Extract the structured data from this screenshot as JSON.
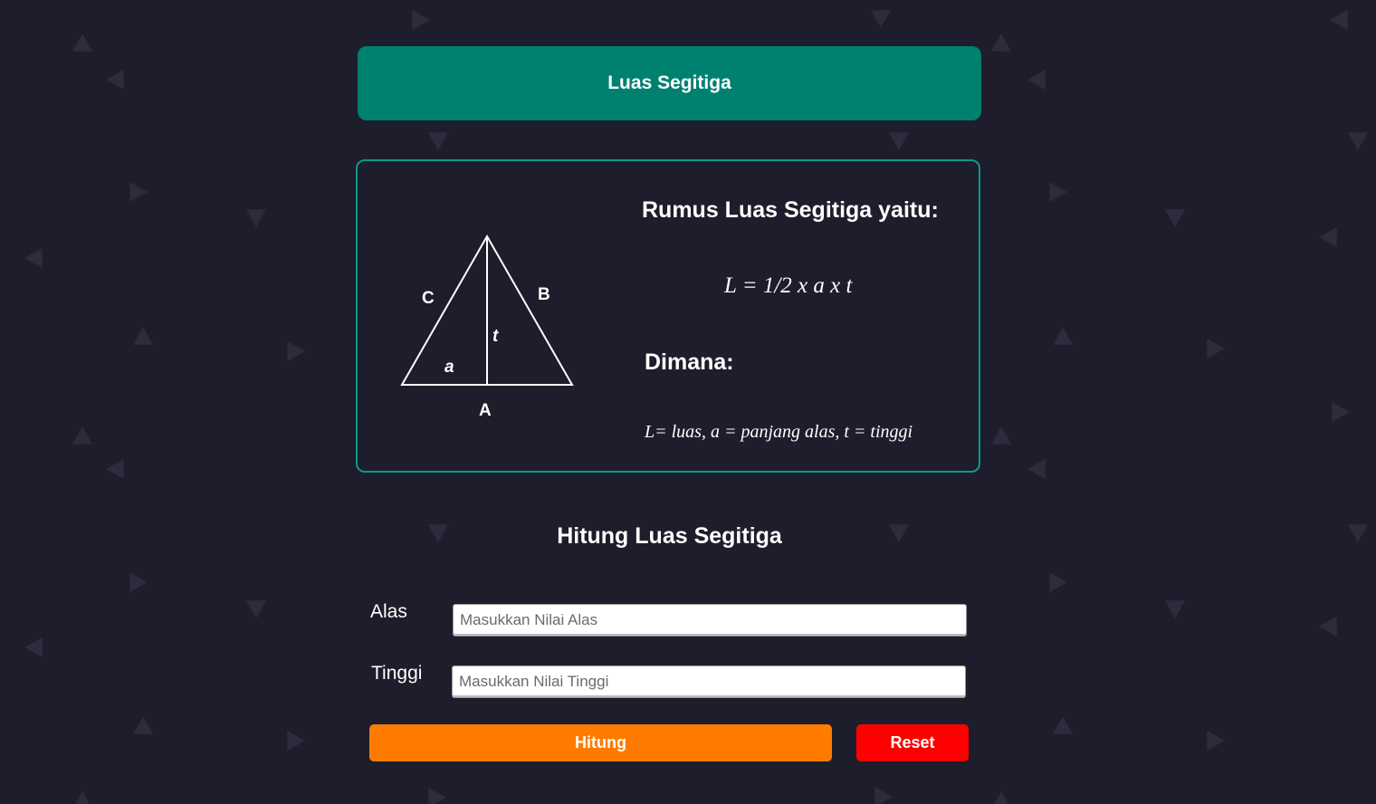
{
  "colors": {
    "background": "#1d1d2b",
    "header": "#008170",
    "card_border": "#0e9a88",
    "hitung_button": "#ff7b00",
    "reset_button": "#ff0000",
    "pattern": "#2c2c3c"
  },
  "header": {
    "title": "Luas Segitiga"
  },
  "formula_card": {
    "heading": "Rumus Luas Segitiga yaitu:",
    "equation": "L = 1/2 x a x t",
    "where_heading": "Dimana:",
    "where_description": "L= luas, a = panjang alas, t = tinggi",
    "diagram_labels": {
      "vertex_c": "C",
      "vertex_b": "B",
      "vertex_a": "A",
      "height": "t",
      "base": "a"
    }
  },
  "calculator": {
    "title": "Hitung Luas Segitiga",
    "alas_label": "Alas",
    "alas_placeholder": "Masukkan Nilai Alas",
    "alas_value": "",
    "tinggi_label": "Tinggi",
    "tinggi_placeholder": "Masukkan Nilai Tinggi",
    "tinggi_value": "",
    "hitung_label": "Hitung",
    "reset_label": "Reset"
  }
}
